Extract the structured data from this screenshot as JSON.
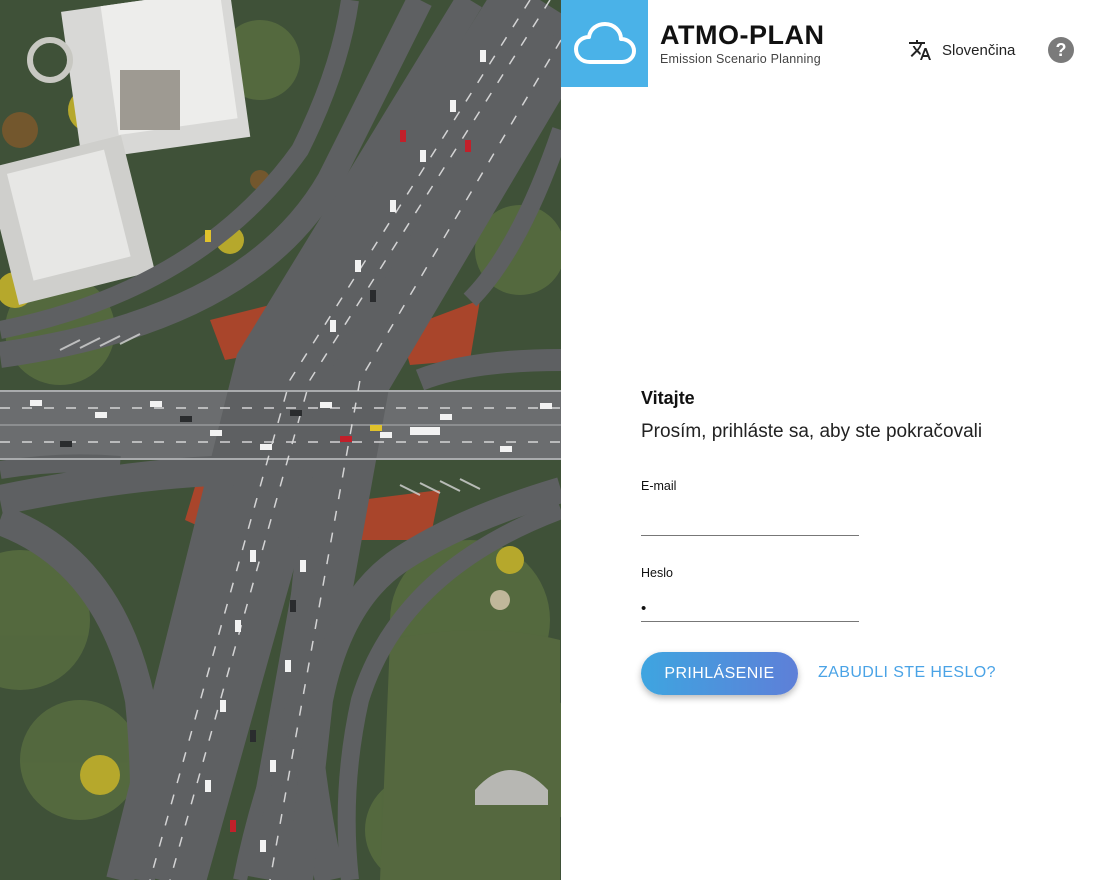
{
  "brand": {
    "name": "ATMO-PLAN",
    "subtitle": "Emission Scenario Planning",
    "logo_icon": "cloud-icon",
    "logo_bg": "#4ab2e8"
  },
  "header": {
    "language_label": "Slovenčina",
    "language_icon": "translate-icon",
    "help_symbol": "?",
    "help_icon": "help-icon"
  },
  "login": {
    "welcome": "Vitajte",
    "subtitle": "Prosím, prihláste sa, aby ste pokračovali",
    "email_label": "E-mail",
    "email_value": "",
    "password_label": "Heslo",
    "password_value": "•",
    "submit_label": "PRIHLÁSENIE",
    "forgot_label": "ZABUDLI STE HESLO?"
  },
  "colors": {
    "accent": "#4aa3e6",
    "button_gradient_start": "#3ea5e0",
    "button_gradient_end": "#5e7fd8"
  },
  "background_image": "aerial-highway-interchange"
}
